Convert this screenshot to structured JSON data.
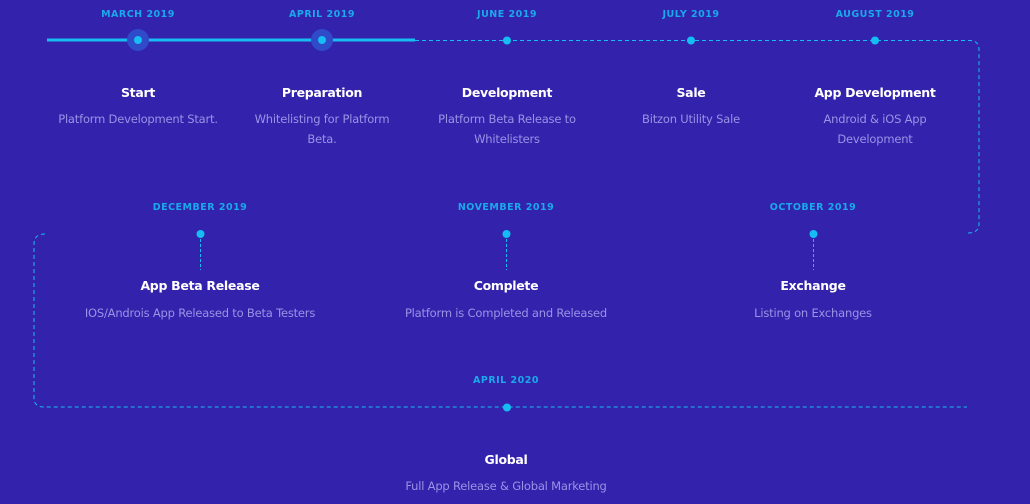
{
  "colors": {
    "background": "#3222ac",
    "accent": "#16bdf2",
    "date_label": "#1aa9ea",
    "title": "#ffffff",
    "description": "#9a93e6",
    "halo": "#2f4bc9"
  },
  "roadmap": {
    "completed_through": "April 2019",
    "row1": [
      {
        "date": "MARCH 2019",
        "title": "Start",
        "description": "Platform Development Start.",
        "status": "done"
      },
      {
        "date": "APRIL 2019",
        "title": "Preparation",
        "description": "Whitelisting for Platform Beta.",
        "status": "done"
      },
      {
        "date": "JUNE 2019",
        "title": "Development",
        "description": "Platform Beta Release to Whitelisters",
        "status": "upcoming"
      },
      {
        "date": "JULY 2019",
        "title": "Sale",
        "description": "Bitzon Utility Sale",
        "status": "upcoming"
      },
      {
        "date": "AUGUST 2019",
        "title": "App Development",
        "description": "Android & iOS App Development",
        "status": "upcoming"
      }
    ],
    "row2": [
      {
        "date": "DECEMBER 2019",
        "title": "App Beta Release",
        "description": "IOS/Androis App Released to Beta Testers",
        "status": "upcoming"
      },
      {
        "date": "NOVEMBER 2019",
        "title": "Complete",
        "description": "Platform is Completed and Released",
        "status": "upcoming"
      },
      {
        "date": "OCTOBER 2019",
        "title": "Exchange",
        "description": "Listing on Exchanges",
        "status": "upcoming"
      }
    ],
    "row3": [
      {
        "date": "APRIL 2020",
        "title": "Global",
        "description": "Full App Release & Global Marketing",
        "status": "upcoming"
      }
    ]
  }
}
